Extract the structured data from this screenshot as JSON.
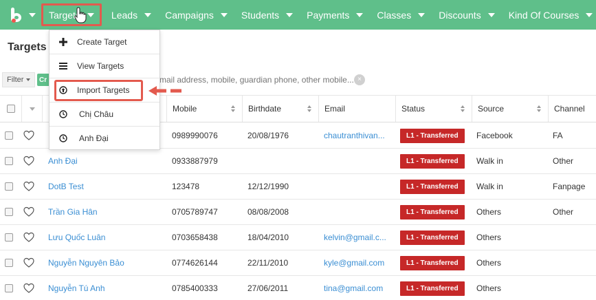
{
  "nav": {
    "logo_icon": "brand-b-logo",
    "items": [
      {
        "label": "Targets"
      },
      {
        "label": "Leads"
      },
      {
        "label": "Campaigns"
      },
      {
        "label": "Students"
      },
      {
        "label": "Payments"
      },
      {
        "label": "Classes"
      },
      {
        "label": "Discounts"
      },
      {
        "label": "Kind Of Courses"
      }
    ]
  },
  "page": {
    "title": "Targets"
  },
  "dropdown": {
    "items": [
      {
        "label": "Create Target",
        "icon": "plus-icon"
      },
      {
        "label": "View Targets",
        "icon": "list-icon"
      },
      {
        "label": "Import Targets",
        "icon": "upload-circle-icon"
      },
      {
        "label": "Chị Châu",
        "icon": "clock-icon"
      },
      {
        "label": "Anh Đại",
        "icon": "clock-icon"
      }
    ]
  },
  "filter": {
    "label": "Filter",
    "tag": "Cr",
    "search_placeholder": "mail address, mobile, guardian phone, other mobile..."
  },
  "table": {
    "columns": [
      "Mobile",
      "Birthdate",
      "Email",
      "Status",
      "Source",
      "Channel"
    ],
    "rows": [
      {
        "name": "",
        "mobile": "0989990076",
        "birthdate": "20/08/1976",
        "email": "chautranthivan...",
        "status": "L1 - Transferred",
        "source": "Facebook",
        "channel": "FA"
      },
      {
        "name": "Anh Đại",
        "mobile": "0933887979",
        "birthdate": "",
        "email": "",
        "status": "L1 - Transferred",
        "source": "Walk in",
        "channel": "Other"
      },
      {
        "name": "DotB Test",
        "mobile": "123478",
        "birthdate": "12/12/1990",
        "email": "",
        "status": "L1 - Transferred",
        "source": "Walk in",
        "channel": "Fanpage"
      },
      {
        "name": "Trần Gia Hân",
        "mobile": "0705789747",
        "birthdate": "08/08/2008",
        "email": "",
        "status": "L1 - Transferred",
        "source": "Others",
        "channel": "Other"
      },
      {
        "name": "Lưu Quốc Luân",
        "mobile": "0703658438",
        "birthdate": "18/04/2010",
        "email": "kelvin@gmail.c...",
        "status": "L1 - Transferred",
        "source": "Others",
        "channel": ""
      },
      {
        "name": "Nguyễn Nguyên Bảo",
        "mobile": "0774626144",
        "birthdate": "22/11/2010",
        "email": "kyle@gmail.com",
        "status": "L1 - Transferred",
        "source": "Others",
        "channel": ""
      },
      {
        "name": "Nguyễn Tú Anh",
        "mobile": "0785400333",
        "birthdate": "27/06/2011",
        "email": "tina@gmail.com",
        "status": "L1 - Transferred",
        "source": "Others",
        "channel": ""
      }
    ]
  },
  "colors": {
    "nav_bg": "#5fbf8a",
    "highlight": "#e35a4e",
    "status_badge": "#c62828",
    "link": "#3a8ed3"
  }
}
